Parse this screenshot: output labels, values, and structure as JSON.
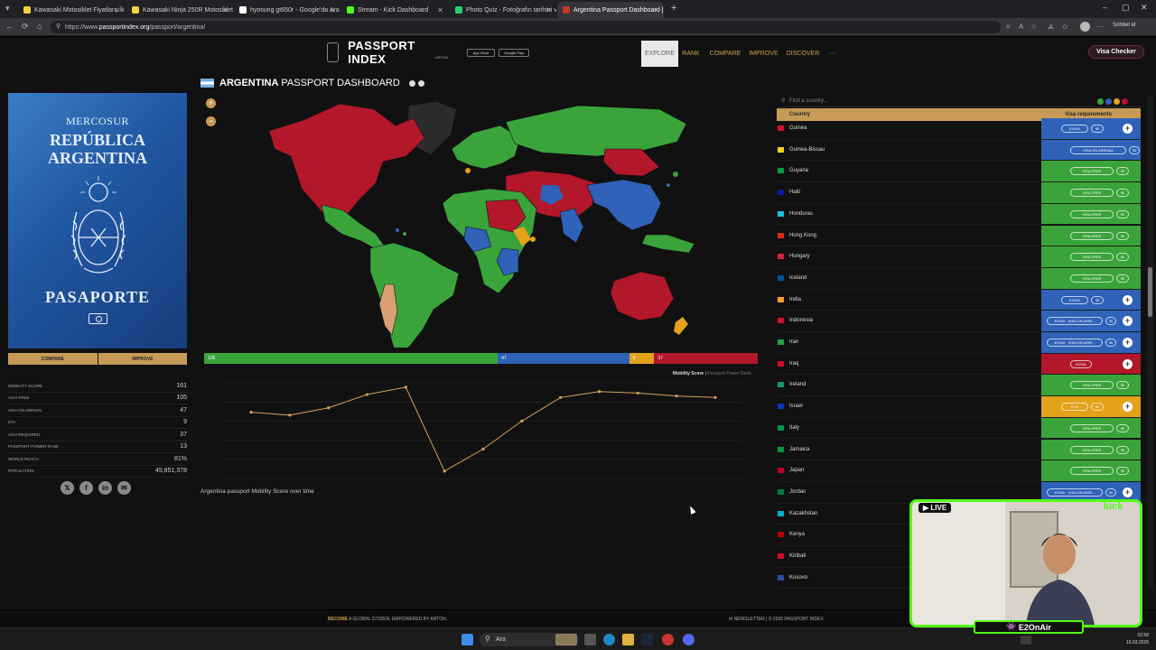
{
  "browser": {
    "tabs": [
      {
        "title": "Kawasaki Motosiklet Fiyatları, İkinci",
        "favicon_color": "#f4d03f"
      },
      {
        "title": "Kawasaki Ninja 250R Motosiklet Fi",
        "favicon_color": "#f4d03f"
      },
      {
        "title": "hyosung gt650r - Google'da Ara",
        "favicon_color": "#ffffff"
      },
      {
        "title": "Stream - Kick Dashboard",
        "favicon_color": "#53fc18"
      },
      {
        "title": "Photo Quiz - Fotoğrafın tarihini ve",
        "favicon_color": "#2ecc71"
      },
      {
        "title": "Argentina Passport Dashboard | F",
        "favicon_color": "#c0392b"
      }
    ],
    "url_prefix": "https://www.",
    "url_domain": "passportindex.org",
    "url_path": "/passport/argentina/",
    "chat_label": "Sohbet et"
  },
  "site": {
    "logo_text": "PASSPORT INDEX",
    "logo_sub": "ARTON",
    "store1": "App Store",
    "store2": "Google Play",
    "menu": [
      "EXPLORE",
      "RANK",
      "COMPARE",
      "IMPROVE",
      "DISCOVER",
      "···"
    ],
    "visa_checker": "Visa Checker"
  },
  "passport": {
    "line1": "MERCOSUR",
    "line2": "REPÚBLICA",
    "line3": "ARGENTINA",
    "line4": "PASAPORTE",
    "compare": "COMPARE",
    "improve": "IMPROVE"
  },
  "stats": [
    {
      "label": "MOBILITY SCORE",
      "value": "161"
    },
    {
      "label": "VISA-FREE",
      "value": "105"
    },
    {
      "label": "VISA ON ARRIVAL",
      "value": "47"
    },
    {
      "label": "ETA",
      "value": "9"
    },
    {
      "label": "VISA REQUIRED",
      "value": "37"
    },
    {
      "label": "PASSPORT POWER RANK",
      "value": "13"
    },
    {
      "label": "WORLD REACH",
      "value": "81%"
    },
    {
      "label": "POPULATION",
      "value": "45,851,378"
    }
  ],
  "dashboard": {
    "title_bold": "ARGENTINA",
    "title_rest": "PASSPORT DASHBOARD",
    "zoom_in": "+",
    "zoom_out": "−",
    "bar": [
      {
        "label": "105",
        "value": 105,
        "color": "#3aa43a"
      },
      {
        "label": "47",
        "value": 47,
        "color": "#2f62b8"
      },
      {
        "label": "9",
        "value": 9,
        "color": "#e3a21a"
      },
      {
        "label": "37",
        "value": 37,
        "color": "#b3172a"
      }
    ],
    "score_label": "Mobility Score",
    "rank_label": "Passport Power Rank",
    "chart_caption": "Argentina passport Mobility Score over time"
  },
  "chart_data": {
    "type": "line",
    "title": "Argentina passport Mobility Score over time",
    "series": [
      {
        "values": [
          160,
          158,
          163,
          172,
          177,
          120,
          135,
          154,
          170,
          174,
          173,
          171,
          170
        ]
      }
    ],
    "color": "#d9a15a",
    "ylim": [
      115,
      180
    ]
  },
  "right": {
    "search_placeholder": "Find a country...",
    "legend_colors": [
      "#3aa43a",
      "#2f62b8",
      "#e3a21a",
      "#b3172a"
    ],
    "col_country": "Country",
    "col_req": "Visa requirements",
    "rows": [
      {
        "name": "Guinea",
        "type": "evisa",
        "pills": [
          "EVISA",
          "90"
        ],
        "plus": true,
        "flag": "#ce1126"
      },
      {
        "name": "Guinea-Bissau",
        "type": "voa",
        "pills": [
          "VISA ON ARRIVAL",
          "90"
        ],
        "plus": false,
        "flag": "#fcd116"
      },
      {
        "name": "Guyana",
        "type": "free",
        "pills": [
          "VISA-FREE",
          "90"
        ],
        "plus": false,
        "flag": "#009e49"
      },
      {
        "name": "Haiti",
        "type": "free",
        "pills": [
          "VISA-FREE",
          "90"
        ],
        "plus": false,
        "flag": "#00209f"
      },
      {
        "name": "Honduras",
        "type": "free",
        "pills": [
          "VISA-FREE",
          "90"
        ],
        "plus": false,
        "flag": "#18c3df"
      },
      {
        "name": "Hong Kong",
        "type": "free",
        "pills": [
          "VISA-FREE",
          "90"
        ],
        "plus": false,
        "flag": "#de2910"
      },
      {
        "name": "Hungary",
        "type": "free",
        "pills": [
          "VISA-FREE",
          "90"
        ],
        "plus": false,
        "flag": "#ce2939"
      },
      {
        "name": "Iceland",
        "type": "free",
        "pills": [
          "VISA-FREE",
          "90"
        ],
        "plus": false,
        "flag": "#02529c"
      },
      {
        "name": "India",
        "type": "evisa",
        "pills": [
          "EVISA",
          "30"
        ],
        "plus": true,
        "flag": "#ff9933"
      },
      {
        "name": "Indonesia",
        "type": "evisa",
        "pills": [
          "EVISA · VISA ON ARRI...",
          "30"
        ],
        "plus": true,
        "flag": "#ce1126"
      },
      {
        "name": "Iran",
        "type": "evisa",
        "pills": [
          "EVISA · VISA ON ARRI...",
          "30"
        ],
        "plus": true,
        "flag": "#239f40"
      },
      {
        "name": "Iraq",
        "type": "req",
        "pills": [
          "EVISA"
        ],
        "plus": true,
        "flag": "#ce1126"
      },
      {
        "name": "Ireland",
        "type": "free",
        "pills": [
          "VISA-FREE",
          "90"
        ],
        "plus": false,
        "flag": "#169b62"
      },
      {
        "name": "Israel",
        "type": "eta",
        "pills": [
          "ETA",
          "90"
        ],
        "plus": true,
        "flag": "#0038b8"
      },
      {
        "name": "Italy",
        "type": "free",
        "pills": [
          "VISA-FREE",
          "90"
        ],
        "plus": false,
        "flag": "#009246"
      },
      {
        "name": "Jamaica",
        "type": "free",
        "pills": [
          "VISA-FREE",
          "90"
        ],
        "plus": false,
        "flag": "#009b3a"
      },
      {
        "name": "Japan",
        "type": "free",
        "pills": [
          "VISA-FREE",
          "90"
        ],
        "plus": false,
        "flag": "#bc002d"
      },
      {
        "name": "Jordan",
        "type": "evisa",
        "pills": [
          "EVISA · VISA ON ARRI...",
          "30"
        ],
        "plus": true,
        "flag": "#007a3d"
      },
      {
        "name": "Kazakhstan",
        "type": "",
        "pills": [],
        "plus": false,
        "flag": "#00afca"
      },
      {
        "name": "Kenya",
        "type": "",
        "pills": [],
        "plus": false,
        "flag": "#bb0000"
      },
      {
        "name": "Kiribati",
        "type": "",
        "pills": [],
        "plus": false,
        "flag": "#ce1126"
      },
      {
        "name": "Kosovo",
        "type": "",
        "pills": [],
        "plus": false,
        "flag": "#244aa5"
      }
    ]
  },
  "footer": {
    "become": "BECOME",
    "global": "A GLOBAL CITIZEN.",
    "empowered": "EMPOWERED BY",
    "arton": "ARTON.",
    "newsletter": "NEWSLETTER",
    "copyright": "| © 2026 PASSPORT INDEX"
  },
  "stream": {
    "live": "LIVE",
    "brand": "kick",
    "name": "E2OnAir"
  },
  "taskbar": {
    "search": "Ara",
    "time": "02:58",
    "date": "16.03.2026"
  }
}
